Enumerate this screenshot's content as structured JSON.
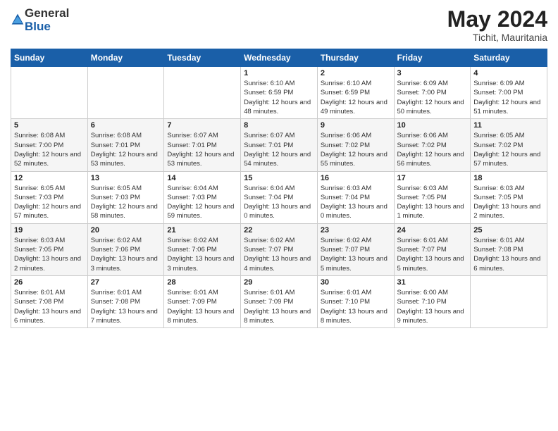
{
  "logo": {
    "general": "General",
    "blue": "Blue"
  },
  "title": {
    "month_year": "May 2024",
    "location": "Tichit, Mauritania"
  },
  "weekdays": [
    "Sunday",
    "Monday",
    "Tuesday",
    "Wednesday",
    "Thursday",
    "Friday",
    "Saturday"
  ],
  "weeks": [
    [
      {
        "day": "",
        "sunrise": "",
        "sunset": "",
        "daylight": ""
      },
      {
        "day": "",
        "sunrise": "",
        "sunset": "",
        "daylight": ""
      },
      {
        "day": "",
        "sunrise": "",
        "sunset": "",
        "daylight": ""
      },
      {
        "day": "1",
        "sunrise": "Sunrise: 6:10 AM",
        "sunset": "Sunset: 6:59 PM",
        "daylight": "Daylight: 12 hours and 48 minutes."
      },
      {
        "day": "2",
        "sunrise": "Sunrise: 6:10 AM",
        "sunset": "Sunset: 6:59 PM",
        "daylight": "Daylight: 12 hours and 49 minutes."
      },
      {
        "day": "3",
        "sunrise": "Sunrise: 6:09 AM",
        "sunset": "Sunset: 7:00 PM",
        "daylight": "Daylight: 12 hours and 50 minutes."
      },
      {
        "day": "4",
        "sunrise": "Sunrise: 6:09 AM",
        "sunset": "Sunset: 7:00 PM",
        "daylight": "Daylight: 12 hours and 51 minutes."
      }
    ],
    [
      {
        "day": "5",
        "sunrise": "Sunrise: 6:08 AM",
        "sunset": "Sunset: 7:00 PM",
        "daylight": "Daylight: 12 hours and 52 minutes."
      },
      {
        "day": "6",
        "sunrise": "Sunrise: 6:08 AM",
        "sunset": "Sunset: 7:01 PM",
        "daylight": "Daylight: 12 hours and 53 minutes."
      },
      {
        "day": "7",
        "sunrise": "Sunrise: 6:07 AM",
        "sunset": "Sunset: 7:01 PM",
        "daylight": "Daylight: 12 hours and 53 minutes."
      },
      {
        "day": "8",
        "sunrise": "Sunrise: 6:07 AM",
        "sunset": "Sunset: 7:01 PM",
        "daylight": "Daylight: 12 hours and 54 minutes."
      },
      {
        "day": "9",
        "sunrise": "Sunrise: 6:06 AM",
        "sunset": "Sunset: 7:02 PM",
        "daylight": "Daylight: 12 hours and 55 minutes."
      },
      {
        "day": "10",
        "sunrise": "Sunrise: 6:06 AM",
        "sunset": "Sunset: 7:02 PM",
        "daylight": "Daylight: 12 hours and 56 minutes."
      },
      {
        "day": "11",
        "sunrise": "Sunrise: 6:05 AM",
        "sunset": "Sunset: 7:02 PM",
        "daylight": "Daylight: 12 hours and 57 minutes."
      }
    ],
    [
      {
        "day": "12",
        "sunrise": "Sunrise: 6:05 AM",
        "sunset": "Sunset: 7:03 PM",
        "daylight": "Daylight: 12 hours and 57 minutes."
      },
      {
        "day": "13",
        "sunrise": "Sunrise: 6:05 AM",
        "sunset": "Sunset: 7:03 PM",
        "daylight": "Daylight: 12 hours and 58 minutes."
      },
      {
        "day": "14",
        "sunrise": "Sunrise: 6:04 AM",
        "sunset": "Sunset: 7:03 PM",
        "daylight": "Daylight: 12 hours and 59 minutes."
      },
      {
        "day": "15",
        "sunrise": "Sunrise: 6:04 AM",
        "sunset": "Sunset: 7:04 PM",
        "daylight": "Daylight: 13 hours and 0 minutes."
      },
      {
        "day": "16",
        "sunrise": "Sunrise: 6:03 AM",
        "sunset": "Sunset: 7:04 PM",
        "daylight": "Daylight: 13 hours and 0 minutes."
      },
      {
        "day": "17",
        "sunrise": "Sunrise: 6:03 AM",
        "sunset": "Sunset: 7:05 PM",
        "daylight": "Daylight: 13 hours and 1 minute."
      },
      {
        "day": "18",
        "sunrise": "Sunrise: 6:03 AM",
        "sunset": "Sunset: 7:05 PM",
        "daylight": "Daylight: 13 hours and 2 minutes."
      }
    ],
    [
      {
        "day": "19",
        "sunrise": "Sunrise: 6:03 AM",
        "sunset": "Sunset: 7:05 PM",
        "daylight": "Daylight: 13 hours and 2 minutes."
      },
      {
        "day": "20",
        "sunrise": "Sunrise: 6:02 AM",
        "sunset": "Sunset: 7:06 PM",
        "daylight": "Daylight: 13 hours and 3 minutes."
      },
      {
        "day": "21",
        "sunrise": "Sunrise: 6:02 AM",
        "sunset": "Sunset: 7:06 PM",
        "daylight": "Daylight: 13 hours and 3 minutes."
      },
      {
        "day": "22",
        "sunrise": "Sunrise: 6:02 AM",
        "sunset": "Sunset: 7:07 PM",
        "daylight": "Daylight: 13 hours and 4 minutes."
      },
      {
        "day": "23",
        "sunrise": "Sunrise: 6:02 AM",
        "sunset": "Sunset: 7:07 PM",
        "daylight": "Daylight: 13 hours and 5 minutes."
      },
      {
        "day": "24",
        "sunrise": "Sunrise: 6:01 AM",
        "sunset": "Sunset: 7:07 PM",
        "daylight": "Daylight: 13 hours and 5 minutes."
      },
      {
        "day": "25",
        "sunrise": "Sunrise: 6:01 AM",
        "sunset": "Sunset: 7:08 PM",
        "daylight": "Daylight: 13 hours and 6 minutes."
      }
    ],
    [
      {
        "day": "26",
        "sunrise": "Sunrise: 6:01 AM",
        "sunset": "Sunset: 7:08 PM",
        "daylight": "Daylight: 13 hours and 6 minutes."
      },
      {
        "day": "27",
        "sunrise": "Sunrise: 6:01 AM",
        "sunset": "Sunset: 7:08 PM",
        "daylight": "Daylight: 13 hours and 7 minutes."
      },
      {
        "day": "28",
        "sunrise": "Sunrise: 6:01 AM",
        "sunset": "Sunset: 7:09 PM",
        "daylight": "Daylight: 13 hours and 8 minutes."
      },
      {
        "day": "29",
        "sunrise": "Sunrise: 6:01 AM",
        "sunset": "Sunset: 7:09 PM",
        "daylight": "Daylight: 13 hours and 8 minutes."
      },
      {
        "day": "30",
        "sunrise": "Sunrise: 6:01 AM",
        "sunset": "Sunset: 7:10 PM",
        "daylight": "Daylight: 13 hours and 8 minutes."
      },
      {
        "day": "31",
        "sunrise": "Sunrise: 6:00 AM",
        "sunset": "Sunset: 7:10 PM",
        "daylight": "Daylight: 13 hours and 9 minutes."
      },
      {
        "day": "",
        "sunrise": "",
        "sunset": "",
        "daylight": ""
      }
    ]
  ]
}
